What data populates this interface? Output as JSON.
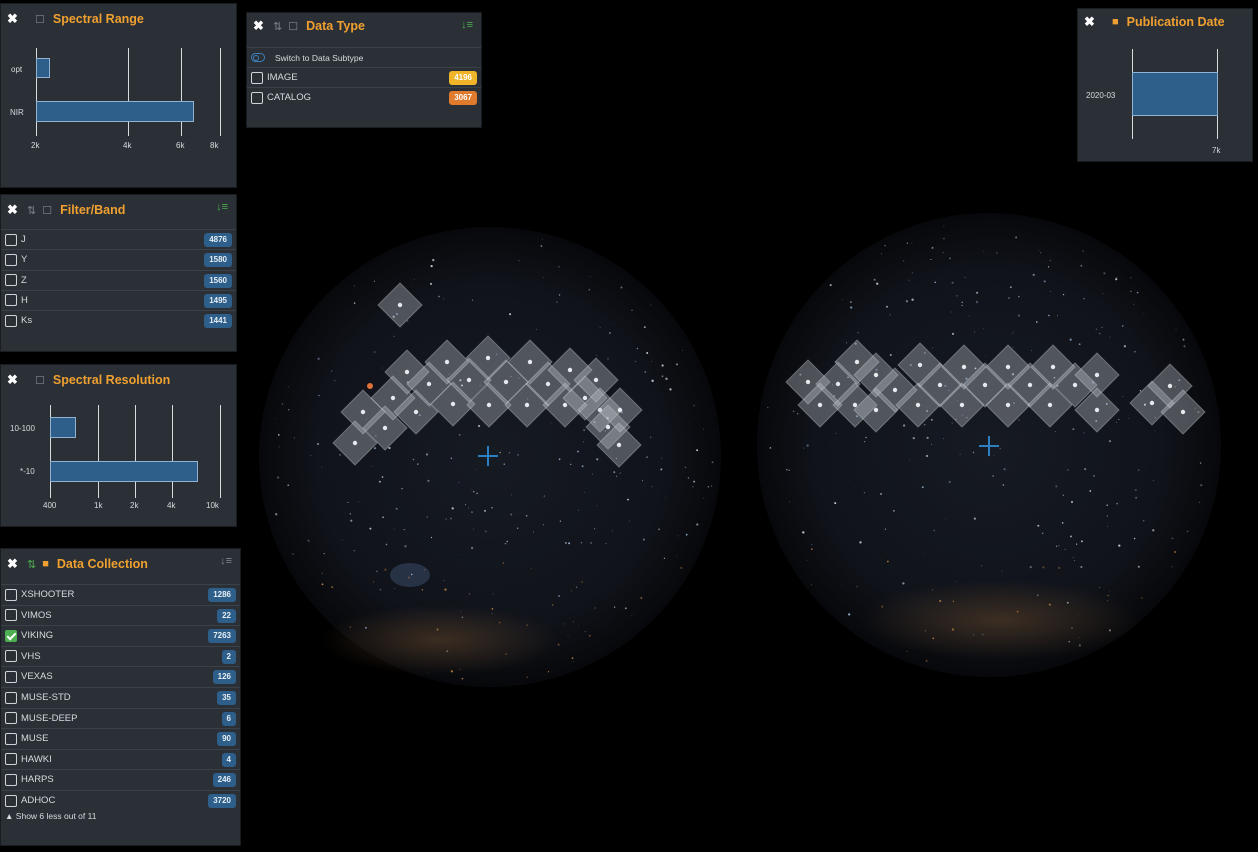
{
  "spectral_range": {
    "title": "Spectral Range",
    "categories": [
      "opt",
      "NIR"
    ],
    "values": [
      2200,
      6900
    ],
    "ticks": [
      "2k",
      "4k",
      "6k",
      "8k"
    ]
  },
  "filter_band": {
    "title": "Filter/Band",
    "items": [
      {
        "label": "J",
        "count": "4876"
      },
      {
        "label": "Y",
        "count": "1580"
      },
      {
        "label": "Z",
        "count": "1560"
      },
      {
        "label": "H",
        "count": "1495"
      },
      {
        "label": "Ks",
        "count": "1441"
      }
    ]
  },
  "spectral_resolution": {
    "title": "Spectral Resolution",
    "categories": [
      "10-100",
      "*-10"
    ],
    "ticks": [
      "400",
      "1k",
      "2k",
      "4k",
      "10k"
    ]
  },
  "data_collection": {
    "title": "Data Collection",
    "items": [
      {
        "label": "XSHOOTER",
        "count": "1286",
        "checked": false
      },
      {
        "label": "VIMOS",
        "count": "22",
        "checked": false
      },
      {
        "label": "VIKING",
        "count": "7263",
        "checked": true
      },
      {
        "label": "VHS",
        "count": "2",
        "checked": false
      },
      {
        "label": "VEXAS",
        "count": "126",
        "checked": false
      },
      {
        "label": "MUSE-STD",
        "count": "35",
        "checked": false
      },
      {
        "label": "MUSE-DEEP",
        "count": "6",
        "checked": false
      },
      {
        "label": "MUSE",
        "count": "90",
        "checked": false
      },
      {
        "label": "HAWKI",
        "count": "4",
        "checked": false
      },
      {
        "label": "HARPS",
        "count": "246",
        "checked": false
      },
      {
        "label": "ADHOC",
        "count": "3720",
        "checked": false
      }
    ],
    "show_less": "Show 6 less out of 11"
  },
  "data_type": {
    "title": "Data Type",
    "switch_label": "Switch to Data Subtype",
    "items": [
      {
        "label": "IMAGE",
        "count": "4196",
        "color": "#f0b429"
      },
      {
        "label": "CATALOG",
        "count": "3067",
        "color": "#e07a2c"
      }
    ]
  },
  "publication_date": {
    "title": "Publication Date",
    "category": "2020-03",
    "tick": "7k"
  },
  "colors": {
    "accent_orange": "#f0a030",
    "bar_blue": "#2e5f8a",
    "check_green": "#4caf50",
    "panel_bg": "#2b3036"
  }
}
